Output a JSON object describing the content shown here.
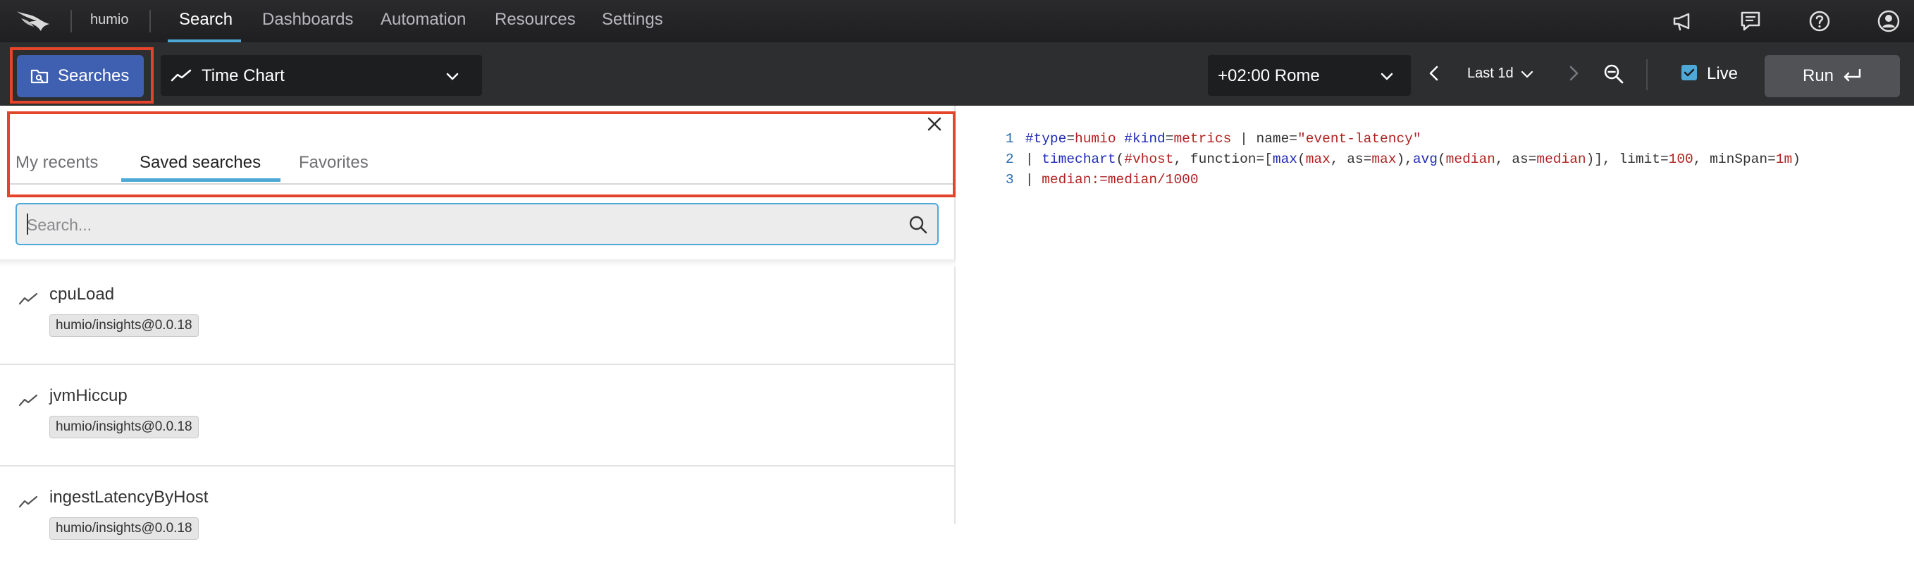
{
  "brand": {
    "name": "humio"
  },
  "nav": {
    "items": [
      {
        "label": "Search",
        "active": true
      },
      {
        "label": "Dashboards",
        "active": false
      },
      {
        "label": "Automation",
        "active": false
      },
      {
        "label": "Resources",
        "active": false
      },
      {
        "label": "Settings",
        "active": false
      }
    ],
    "right_icons": [
      "megaphone-icon",
      "chat-icon",
      "help-icon",
      "user-icon"
    ]
  },
  "toolbar": {
    "searches_label": "Searches",
    "visualization_label": "Time Chart",
    "timezone_label": "+02:00 Rome",
    "range_label": "Last 1d",
    "live_label": "Live",
    "live_checked": true,
    "run_label": "Run"
  },
  "panel": {
    "tabs": [
      {
        "label": "My recents",
        "active": false
      },
      {
        "label": "Saved searches",
        "active": true
      },
      {
        "label": "Favorites",
        "active": false
      }
    ],
    "search_placeholder": "Search...",
    "items": [
      {
        "name": "cpuLoad",
        "tag": "humio/insights@0.0.18"
      },
      {
        "name": "jvmHiccup",
        "tag": "humio/insights@0.0.18"
      },
      {
        "name": "ingestLatencyByHost",
        "tag": "humio/insights@0.0.18"
      }
    ]
  },
  "editor": {
    "line_numbers": [
      "1",
      "2",
      "3"
    ],
    "line1": {
      "a": "#type",
      "b": "=",
      "c": "humio",
      "d": " ",
      "e": "#kind",
      "f": "=",
      "g": "metrics",
      "h": " | name=",
      "i": "\"event-latency\""
    },
    "line2": {
      "a": "| ",
      "b": "timechart",
      "c": "(",
      "d": "#vhost",
      "e": ", function=[",
      "f": "max",
      "g": "(",
      "h": "max",
      "i": ", as=",
      "j": "max",
      "k": "),",
      "l": "avg",
      "m": "(",
      "n": "median",
      "o": ", as=",
      "p": "median",
      "q": ")], limit=",
      "r": "100",
      "s": ", minSpan=",
      "t": "1m",
      "u": ")"
    },
    "line3": {
      "a": "| ",
      "b": "median",
      "c": ":=median/1000"
    }
  },
  "colors": {
    "accent": "#4ea9d8",
    "highlight": "#e2452b",
    "primary_button": "#3f5fb0"
  }
}
